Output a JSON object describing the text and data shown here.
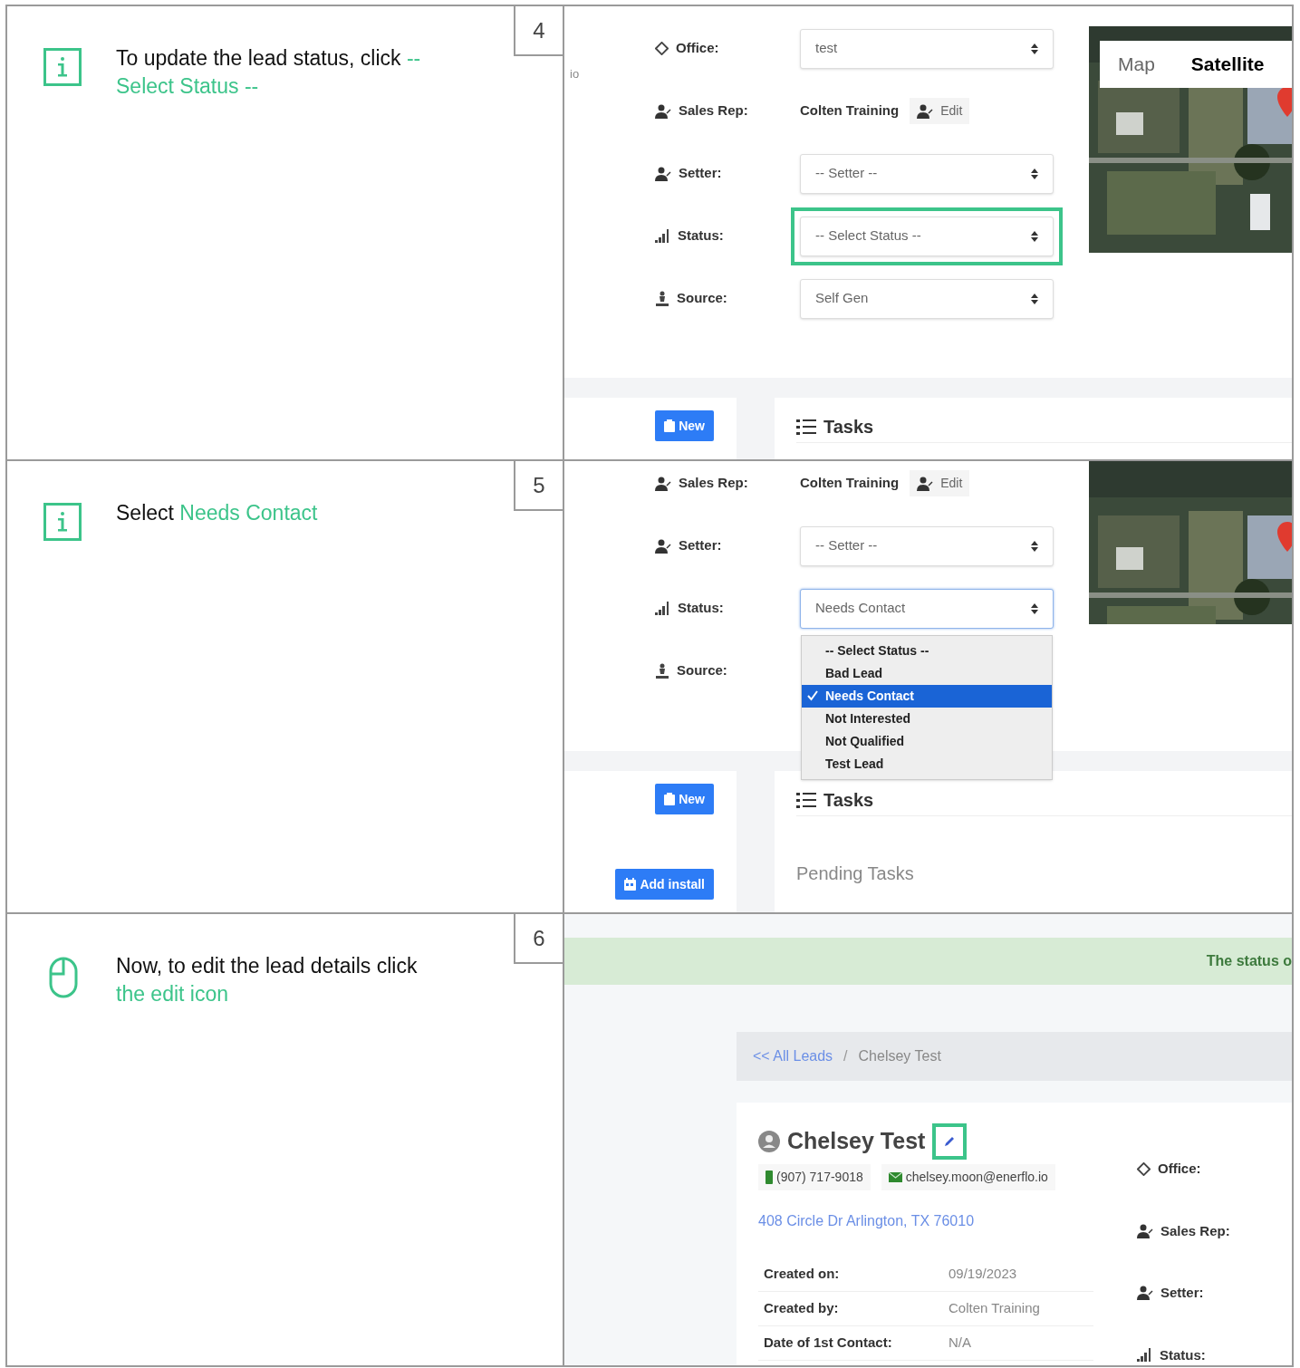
{
  "steps": [
    {
      "number": "4",
      "kind": "info",
      "instruction": {
        "text": "To update the lead status, click ",
        "highlight": "-- Select Status --"
      },
      "screen": {
        "kind": "form",
        "side_text": "io",
        "fields": [
          {
            "kind": "diamond",
            "label": "Office:",
            "value": "test",
            "highlighted": false
          },
          {
            "kind": "user",
            "label": "Sales Rep:",
            "value": "Colten Training",
            "button": "Edit"
          },
          {
            "kind": "user",
            "label": "Setter:",
            "value": "-- Setter --",
            "highlighted": false
          },
          {
            "kind": "bars",
            "label": "Status:",
            "value": "-- Select Status --",
            "highlighted": true
          },
          {
            "kind": "person",
            "label": "Source:",
            "value": "Self Gen",
            "highlighted": false
          }
        ],
        "map": {
          "tabs": [
            {
              "label": "Map",
              "selected": false
            },
            {
              "label": "Satellite",
              "selected": true
            }
          ]
        },
        "buttons": [
          {
            "label": "New",
            "kind": "new"
          }
        ],
        "tasks_title": "Tasks"
      }
    },
    {
      "number": "5",
      "kind": "info",
      "instruction": {
        "text": "Select ",
        "highlight": "Needs Contact"
      },
      "screen": {
        "kind": "form",
        "fields": [
          {
            "kind": "user",
            "label": "Sales Rep:",
            "value": "Colten Training",
            "button": "Edit"
          },
          {
            "kind": "user",
            "label": "Setter:",
            "value": "-- Setter --",
            "highlighted": false
          },
          {
            "kind": "bars",
            "label": "Status:",
            "value": "Needs Contact",
            "highlighted": false,
            "focused": true,
            "options": [
              {
                "label": "-- Select Status --",
                "selected": false
              },
              {
                "label": "Bad Lead",
                "selected": false
              },
              {
                "label": "Needs Contact",
                "selected": true
              },
              {
                "label": "Not Interested",
                "selected": false
              },
              {
                "label": "Not Qualified",
                "selected": false
              },
              {
                "label": "Test Lead",
                "selected": false
              }
            ]
          },
          {
            "kind": "person",
            "label": "Source:"
          }
        ],
        "buttons": [
          {
            "label": "New",
            "kind": "new"
          },
          {
            "label": "Add install",
            "kind": "install"
          }
        ],
        "tasks_title": "Tasks",
        "tasks_subtitle": "Pending Tasks"
      }
    },
    {
      "number": "6",
      "kind": "mouse",
      "instruction": {
        "text": "Now, to edit the lead details click ",
        "highlight": "the edit icon"
      },
      "screen": {
        "kind": "detail",
        "banner": "The status o",
        "breadcrumb": {
          "link": "<< All Leads",
          "separator": "/",
          "current": "Chelsey Test"
        },
        "name": "Chelsey Test",
        "edit_highlighted": true,
        "phone": "(907) 717-9018",
        "email": "chelsey.moon@enerflo.io",
        "address": "408 Circle Dr Arlington, TX 76010",
        "details": [
          {
            "label": "Created on:",
            "value": "09/19/2023"
          },
          {
            "label": "Created by:",
            "value": "Colten Training"
          },
          {
            "label": "Date of 1st Contact:",
            "value": "N/A"
          }
        ],
        "side_labels": [
          {
            "kind": "diamond",
            "label": "Office:"
          },
          {
            "kind": "user",
            "label": "Sales Rep:"
          },
          {
            "kind": "user",
            "label": "Setter:"
          },
          {
            "kind": "bars",
            "label": "Status:"
          }
        ]
      }
    }
  ]
}
